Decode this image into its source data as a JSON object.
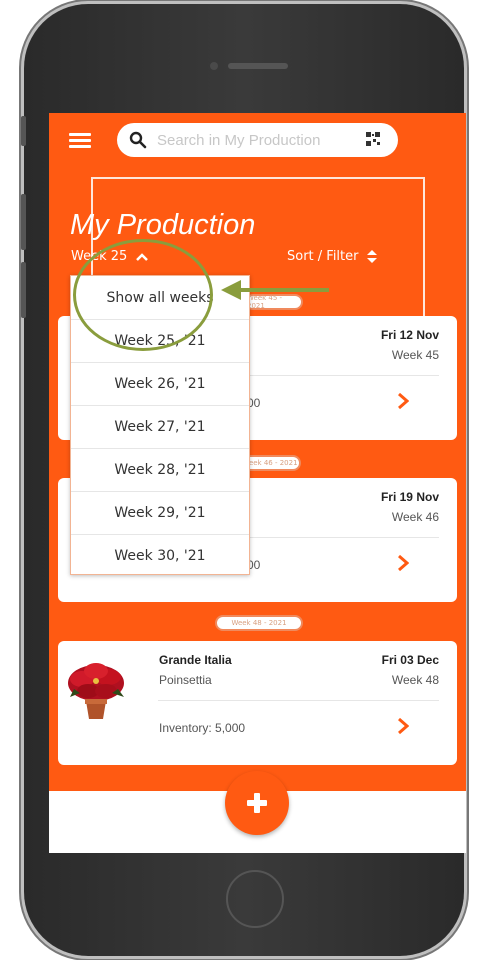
{
  "colors": {
    "accent": "#ff5a12",
    "annotation": "#8a9d3d"
  },
  "header": {
    "menu_icon": "hamburger-icon",
    "search_placeholder": "Search in My Production",
    "search_icon": "search-icon",
    "qr_icon": "qr-code-icon"
  },
  "page": {
    "title": "My Production",
    "week_selector": "Week 25",
    "sort_filter": "Sort / Filter"
  },
  "dropdown": {
    "items": [
      "Show all weeks",
      "Week 25, '21",
      "Week 26, '21",
      "Week 27, '21",
      "Week 28, '21",
      "Week 29, '21",
      "Week 30, '21"
    ]
  },
  "badges": [
    "Week 45 - 2021",
    "Week 46 - 2021",
    "Week 48 - 2021"
  ],
  "cards": [
    {
      "date": "Fri 12 Nov",
      "week": "Week 45",
      "inventory_fragment": "00"
    },
    {
      "date": "Fri 19 Nov",
      "week": "Week 46",
      "inventory_fragment": "00"
    },
    {
      "name": "Grande Italia",
      "type": "Poinsettia",
      "date": "Fri 03 Dec",
      "week": "Week 48",
      "inventory": "Inventory: 5,000"
    }
  ],
  "fab": {
    "icon": "plus-icon"
  }
}
